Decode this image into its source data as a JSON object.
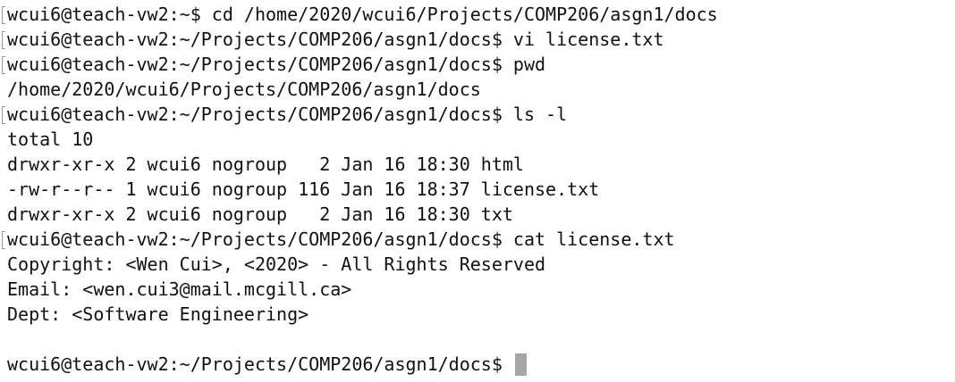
{
  "terminal": {
    "lines": [
      "wcui6@teach-vw2:~$ cd /home/2020/wcui6/Projects/COMP206/asgn1/docs",
      "wcui6@teach-vw2:~/Projects/COMP206/asgn1/docs$ vi license.txt",
      "wcui6@teach-vw2:~/Projects/COMP206/asgn1/docs$ pwd",
      "/home/2020/wcui6/Projects/COMP206/asgn1/docs",
      "wcui6@teach-vw2:~/Projects/COMP206/asgn1/docs$ ls -l",
      "total 10",
      "drwxr-xr-x 2 wcui6 nogroup   2 Jan 16 18:30 html",
      "-rw-r--r-- 1 wcui6 nogroup 116 Jan 16 18:37 license.txt",
      "drwxr-xr-x 2 wcui6 nogroup   2 Jan 16 18:30 txt",
      "wcui6@teach-vw2:~/Projects/COMP206/asgn1/docs$ cat license.txt",
      "Copyright: <Wen Cui>, <2020> - All Rights Reserved",
      "Email: <wen.cui3@mail.mcgill.ca>",
      "Dept: <Software Engineering>",
      "",
      "wcui6@teach-vw2:~/Projects/COMP206/asgn1/docs$ "
    ]
  }
}
